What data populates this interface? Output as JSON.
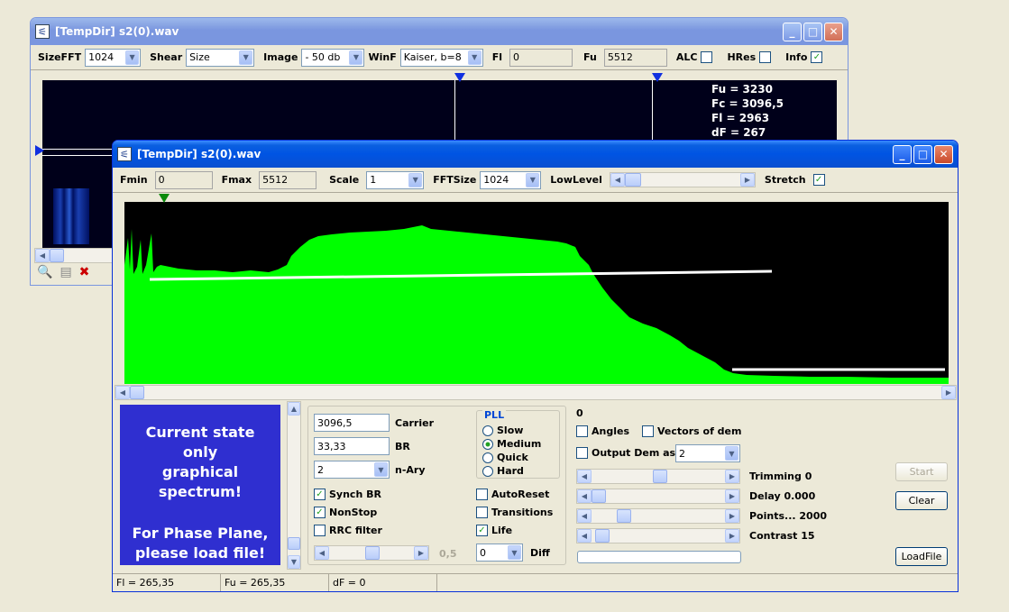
{
  "back_window": {
    "title": "[TempDir] s2(0).wav",
    "toolbar": {
      "sizefft_label": "SizeFFT",
      "sizefft_value": "1024",
      "shear_label": "Shear",
      "shear_value": "Size",
      "image_label": "Image",
      "image_value": "- 50 db",
      "winf_label": "WinF",
      "winf_value": "Kaiser, b=8",
      "fl_label": "Fl",
      "fl_value": "0",
      "fu_label": "Fu",
      "fu_value": "5512",
      "alc_label": "ALC",
      "alc_checked": false,
      "hres_label": "HRes",
      "hres_checked": false,
      "info_label": "Info",
      "info_checked": true
    },
    "info": {
      "fu": "Fu = 3230",
      "fc": "Fc = 3096,5",
      "fl": "Fl = 2963",
      "df": "dF = 267"
    }
  },
  "front_window": {
    "title": "[TempDir] s2(0).wav",
    "toolbar": {
      "fmin_label": "Fmin",
      "fmin_value": "0",
      "fmax_label": "Fmax",
      "fmax_value": "5512",
      "scale_label": "Scale",
      "scale_value": "1",
      "fftsize_label": "FFTSize",
      "fftsize_value": "1024",
      "lowlevel_label": "LowLevel",
      "stretch_label": "Stretch",
      "stretch_checked": true
    },
    "message": {
      "line1": "Current state",
      "line2": "only",
      "line3": "graphical spectrum!",
      "line4": "For Phase Plane,",
      "line5": "please load file!"
    },
    "params": {
      "carrier_value": "3096,5",
      "carrier_label": "Carrier",
      "br_value": "33,33",
      "br_label": "BR",
      "nary_value": "2",
      "nary_label": "n-Ary",
      "synch_br_label": "Synch BR",
      "synch_br_checked": true,
      "nonstop_label": "NonStop",
      "nonstop_checked": true,
      "rrc_label": "RRC filter",
      "rrc_checked": false,
      "slider_value": "0,5"
    },
    "pll": {
      "label": "PLL",
      "options": [
        "Slow",
        "Medium",
        "Quick",
        "Hard"
      ],
      "selected": "Medium"
    },
    "options": {
      "autoreset_label": "AutoReset",
      "autoreset_checked": false,
      "transitions_label": "Transitions",
      "transitions_checked": false,
      "life_label": "Life",
      "life_checked": true,
      "diff_value": "0",
      "diff_label": "Diff"
    },
    "right": {
      "zero_value": "0",
      "angles_label": "Angles",
      "vectors_label": "Vectors of dem",
      "output_dem_label": "Output Dem as",
      "output_dem_value": "2",
      "trimming_label": "Trimming 0",
      "delay_label": "Delay  0.000",
      "points_label": "Points... 2000",
      "contrast_label": "Contrast 15",
      "start_label": "Start",
      "clear_label": "Clear",
      "loadfile_label": "LoadFile"
    },
    "status": {
      "fl": "Fl = 265,35",
      "fu": "Fu = 265,35",
      "df": "dF = 0"
    }
  },
  "colors": {
    "spectrum_fill": "#00ff00",
    "spectrum_bg": "#000000",
    "waterfall_bg": "#000020",
    "message_bg": "#2f2fd0"
  }
}
